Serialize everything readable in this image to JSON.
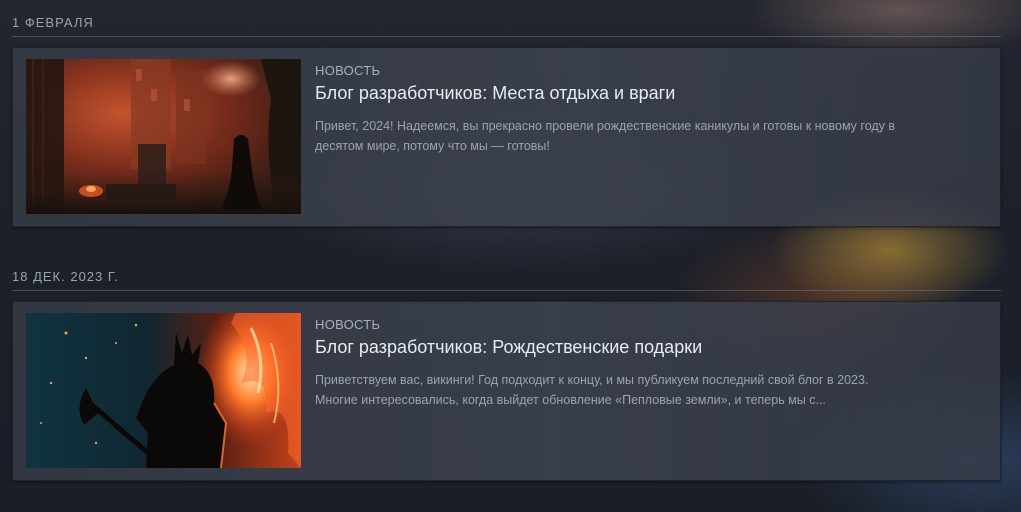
{
  "feed": [
    {
      "date": "1 февраля",
      "type": "НОВОСТЬ",
      "title": "Блог разработчиков: Места отдыха и враги",
      "summary": "Привет, 2024! Надеемся, вы прекрасно провели рождественские каникулы и готовы к новому году в десятом мире, потому что мы — готовы!",
      "thumbnail_icon": "dark-castle-figure-image"
    },
    {
      "date": "18 дек. 2023 г.",
      "type": "НОВОСТЬ",
      "title": "Блог разработчиков: Рождественские подарки",
      "summary": "Приветствуем вас, викинги! Год подходит к концу, и мы публикуем последний свой блог в 2023. Многие интересовались, когда выйдет обновление «Пепловые земли», и теперь мы с...",
      "thumbnail_icon": "viking-warrior-fire-image"
    }
  ]
}
